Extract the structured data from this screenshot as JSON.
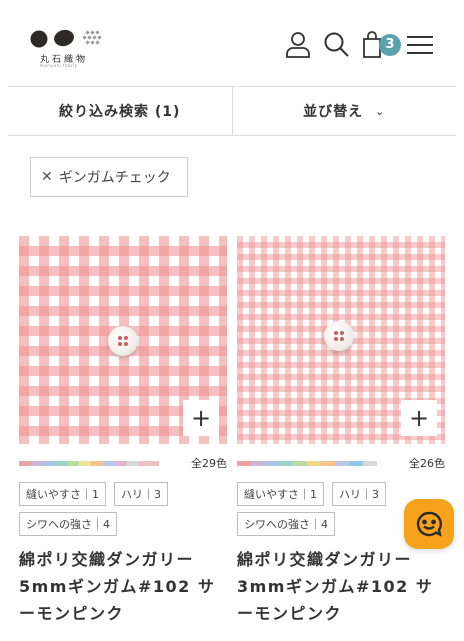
{
  "header": {
    "logo_text": "丸石織物",
    "logo_sub": "maruishi fabric",
    "cart_count": "3",
    "icons": [
      "user-icon",
      "search-icon",
      "cart-icon",
      "menu-icon"
    ]
  },
  "filter_bar": {
    "filter_label": "絞り込み検索 (1)",
    "sort_label": "並び替え",
    "sort_chevron": "⌄"
  },
  "active_filter": {
    "remove_glyph": "✕",
    "label": "ギンガムチェック"
  },
  "products": [
    {
      "color_count": "全29色",
      "tags": [
        "縫いやすさ｜1",
        "ハリ｜3",
        "シワへの強さ｜4"
      ],
      "name": "綿ポリ交織ダンガリー 5mmギンガム#102 サーモンピンク",
      "add_glyph": "+"
    },
    {
      "color_count": "全26色",
      "tags": [
        "縫いやすさ｜1",
        "ハリ｜3",
        "シワへの強さ｜4"
      ],
      "name": "綿ポリ交織ダンガリー 3mmギンガム#102 サーモンピンク",
      "add_glyph": "+"
    }
  ],
  "colors": {
    "accent_teal": "#5aa2ad",
    "chat_orange": "#f7a21b",
    "gingham_pink": "#f08c8c"
  }
}
